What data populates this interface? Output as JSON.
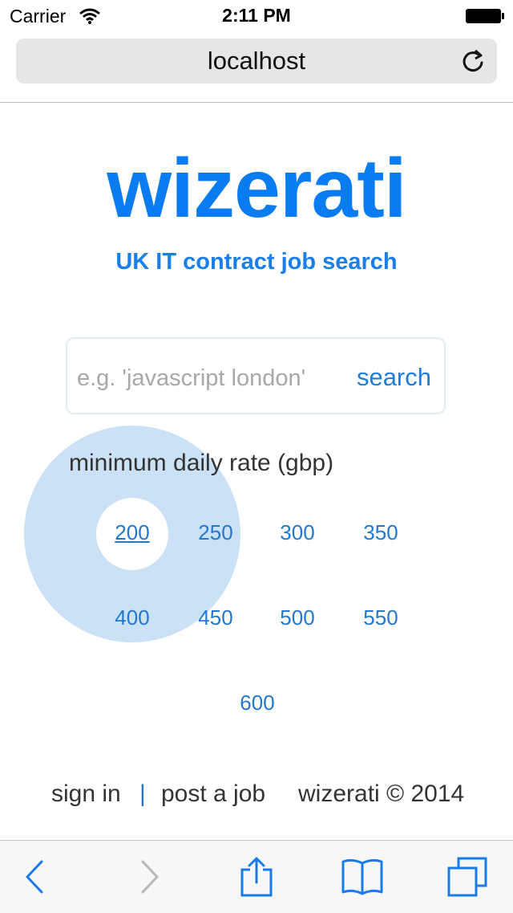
{
  "status_bar": {
    "carrier": "Carrier",
    "time": "2:11 PM",
    "icons": [
      "wifi-icon",
      "battery-icon"
    ]
  },
  "browser": {
    "url": "localhost",
    "reload_icon": "reload-icon"
  },
  "brand": {
    "logo": "wizerati",
    "tagline": "UK IT contract job search",
    "accent_color": "#0a7cf2"
  },
  "search": {
    "placeholder": "e.g. 'javascript london'",
    "value": "",
    "button_label": "search"
  },
  "rates": {
    "title": "minimum daily rate (gbp)",
    "selected": "200",
    "options": [
      "200",
      "250",
      "300",
      "350",
      "400",
      "450",
      "500",
      "550",
      "600"
    ]
  },
  "footer": {
    "sign_in": "sign in",
    "separator": "|",
    "post_job": "post a job",
    "copyright": "wizerati © 2014"
  },
  "toolbar": {
    "icons": [
      "back-icon",
      "forward-icon",
      "share-icon",
      "bookmarks-icon",
      "tabs-icon"
    ]
  }
}
